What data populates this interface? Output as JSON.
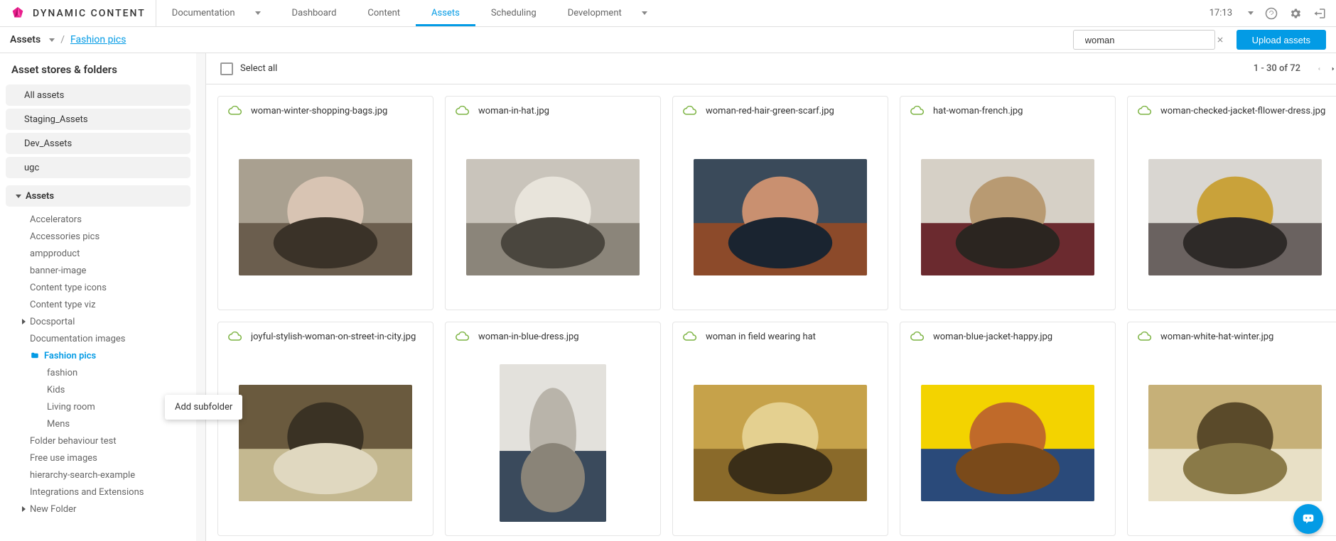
{
  "brand": {
    "name": "DYNAMIC CONTENT"
  },
  "topnav": {
    "documentation": "Documentation",
    "dashboard": "Dashboard",
    "content": "Content",
    "assets": "Assets",
    "scheduling": "Scheduling",
    "development": "Development"
  },
  "clock": "17:13",
  "breadcrumb": {
    "root": "Assets",
    "current": "Fashion pics"
  },
  "search": {
    "value": "woman"
  },
  "upload_label": "Upload assets",
  "sidebar": {
    "title": "Asset stores & folders",
    "pills": [
      "All assets",
      "Staging_Assets",
      "Dev_Assets",
      "ugc"
    ],
    "tree_root_label": "Assets",
    "folders": [
      {
        "label": "Accelerators",
        "expandable": false
      },
      {
        "label": "Accessories pics",
        "expandable": false
      },
      {
        "label": "ampproduct",
        "expandable": false
      },
      {
        "label": "banner-image",
        "expandable": false
      },
      {
        "label": "Content type icons",
        "expandable": false
      },
      {
        "label": "Content type viz",
        "expandable": false
      },
      {
        "label": "Docsportal",
        "expandable": true
      },
      {
        "label": "Documentation images",
        "expandable": false
      },
      {
        "label": "Fashion pics",
        "expandable": false,
        "selected": true,
        "children": [
          "fashion",
          "Kids",
          "Living room",
          "Mens"
        ]
      },
      {
        "label": "Folder behaviour test",
        "expandable": false
      },
      {
        "label": "Free use images",
        "expandable": false
      },
      {
        "label": "hierarchy-search-example",
        "expandable": false
      },
      {
        "label": "Integrations and Extensions",
        "expandable": false
      },
      {
        "label": "New Folder",
        "expandable": true
      }
    ]
  },
  "tooltip": "Add subfolder",
  "content_bar": {
    "select_all": "Select all",
    "page_info": "1 - 30 of 72"
  },
  "assets": [
    {
      "name": "woman-winter-shopping-bags.jpg",
      "orient": "landscape",
      "palette": [
        "#a9a090",
        "#6b5e4e",
        "#d8c4b3",
        "#3a3228"
      ]
    },
    {
      "name": "woman-in-hat.jpg",
      "orient": "landscape",
      "palette": [
        "#c9c4bb",
        "#8b857a",
        "#e8e4db",
        "#4a463e"
      ]
    },
    {
      "name": "woman-red-hair-green-scarf.jpg",
      "orient": "landscape",
      "palette": [
        "#3a4a5a",
        "#8c4a2a",
        "#c99070",
        "#1a2430"
      ]
    },
    {
      "name": "hat-woman-french.jpg",
      "orient": "landscape",
      "palette": [
        "#d6d0c6",
        "#6b2a2f",
        "#b89a72",
        "#2b2520"
      ]
    },
    {
      "name": "woman-checked-jacket-fllower-dress.jpg",
      "orient": "landscape",
      "palette": [
        "#d9d6d1",
        "#6a6260",
        "#c9a23a",
        "#2e2a28"
      ]
    },
    {
      "name": "joyful-stylish-woman-on-street-in-city.jpg",
      "orient": "landscape",
      "palette": [
        "#6a5a3e",
        "#c4b890",
        "#3a3224",
        "#e0d8c0"
      ]
    },
    {
      "name": "woman-in-blue-dress.jpg",
      "orient": "portrait",
      "palette": [
        "#e3e1dc",
        "#3a4a5c",
        "#b9b4aa",
        "#8a8478"
      ]
    },
    {
      "name": "woman in field wearing hat",
      "orient": "landscape",
      "palette": [
        "#c6a24a",
        "#8a6a2a",
        "#e4d090",
        "#3a2e18"
      ]
    },
    {
      "name": "woman-blue-jacket-happy.jpg",
      "orient": "landscape",
      "palette": [
        "#f3d300",
        "#2a4a7a",
        "#c06a2a",
        "#7a4a1a"
      ]
    },
    {
      "name": "woman-white-hat-winter.jpg",
      "orient": "landscape",
      "palette": [
        "#c6b078",
        "#e8e0c6",
        "#5a4a2a",
        "#8a7a48"
      ]
    }
  ]
}
